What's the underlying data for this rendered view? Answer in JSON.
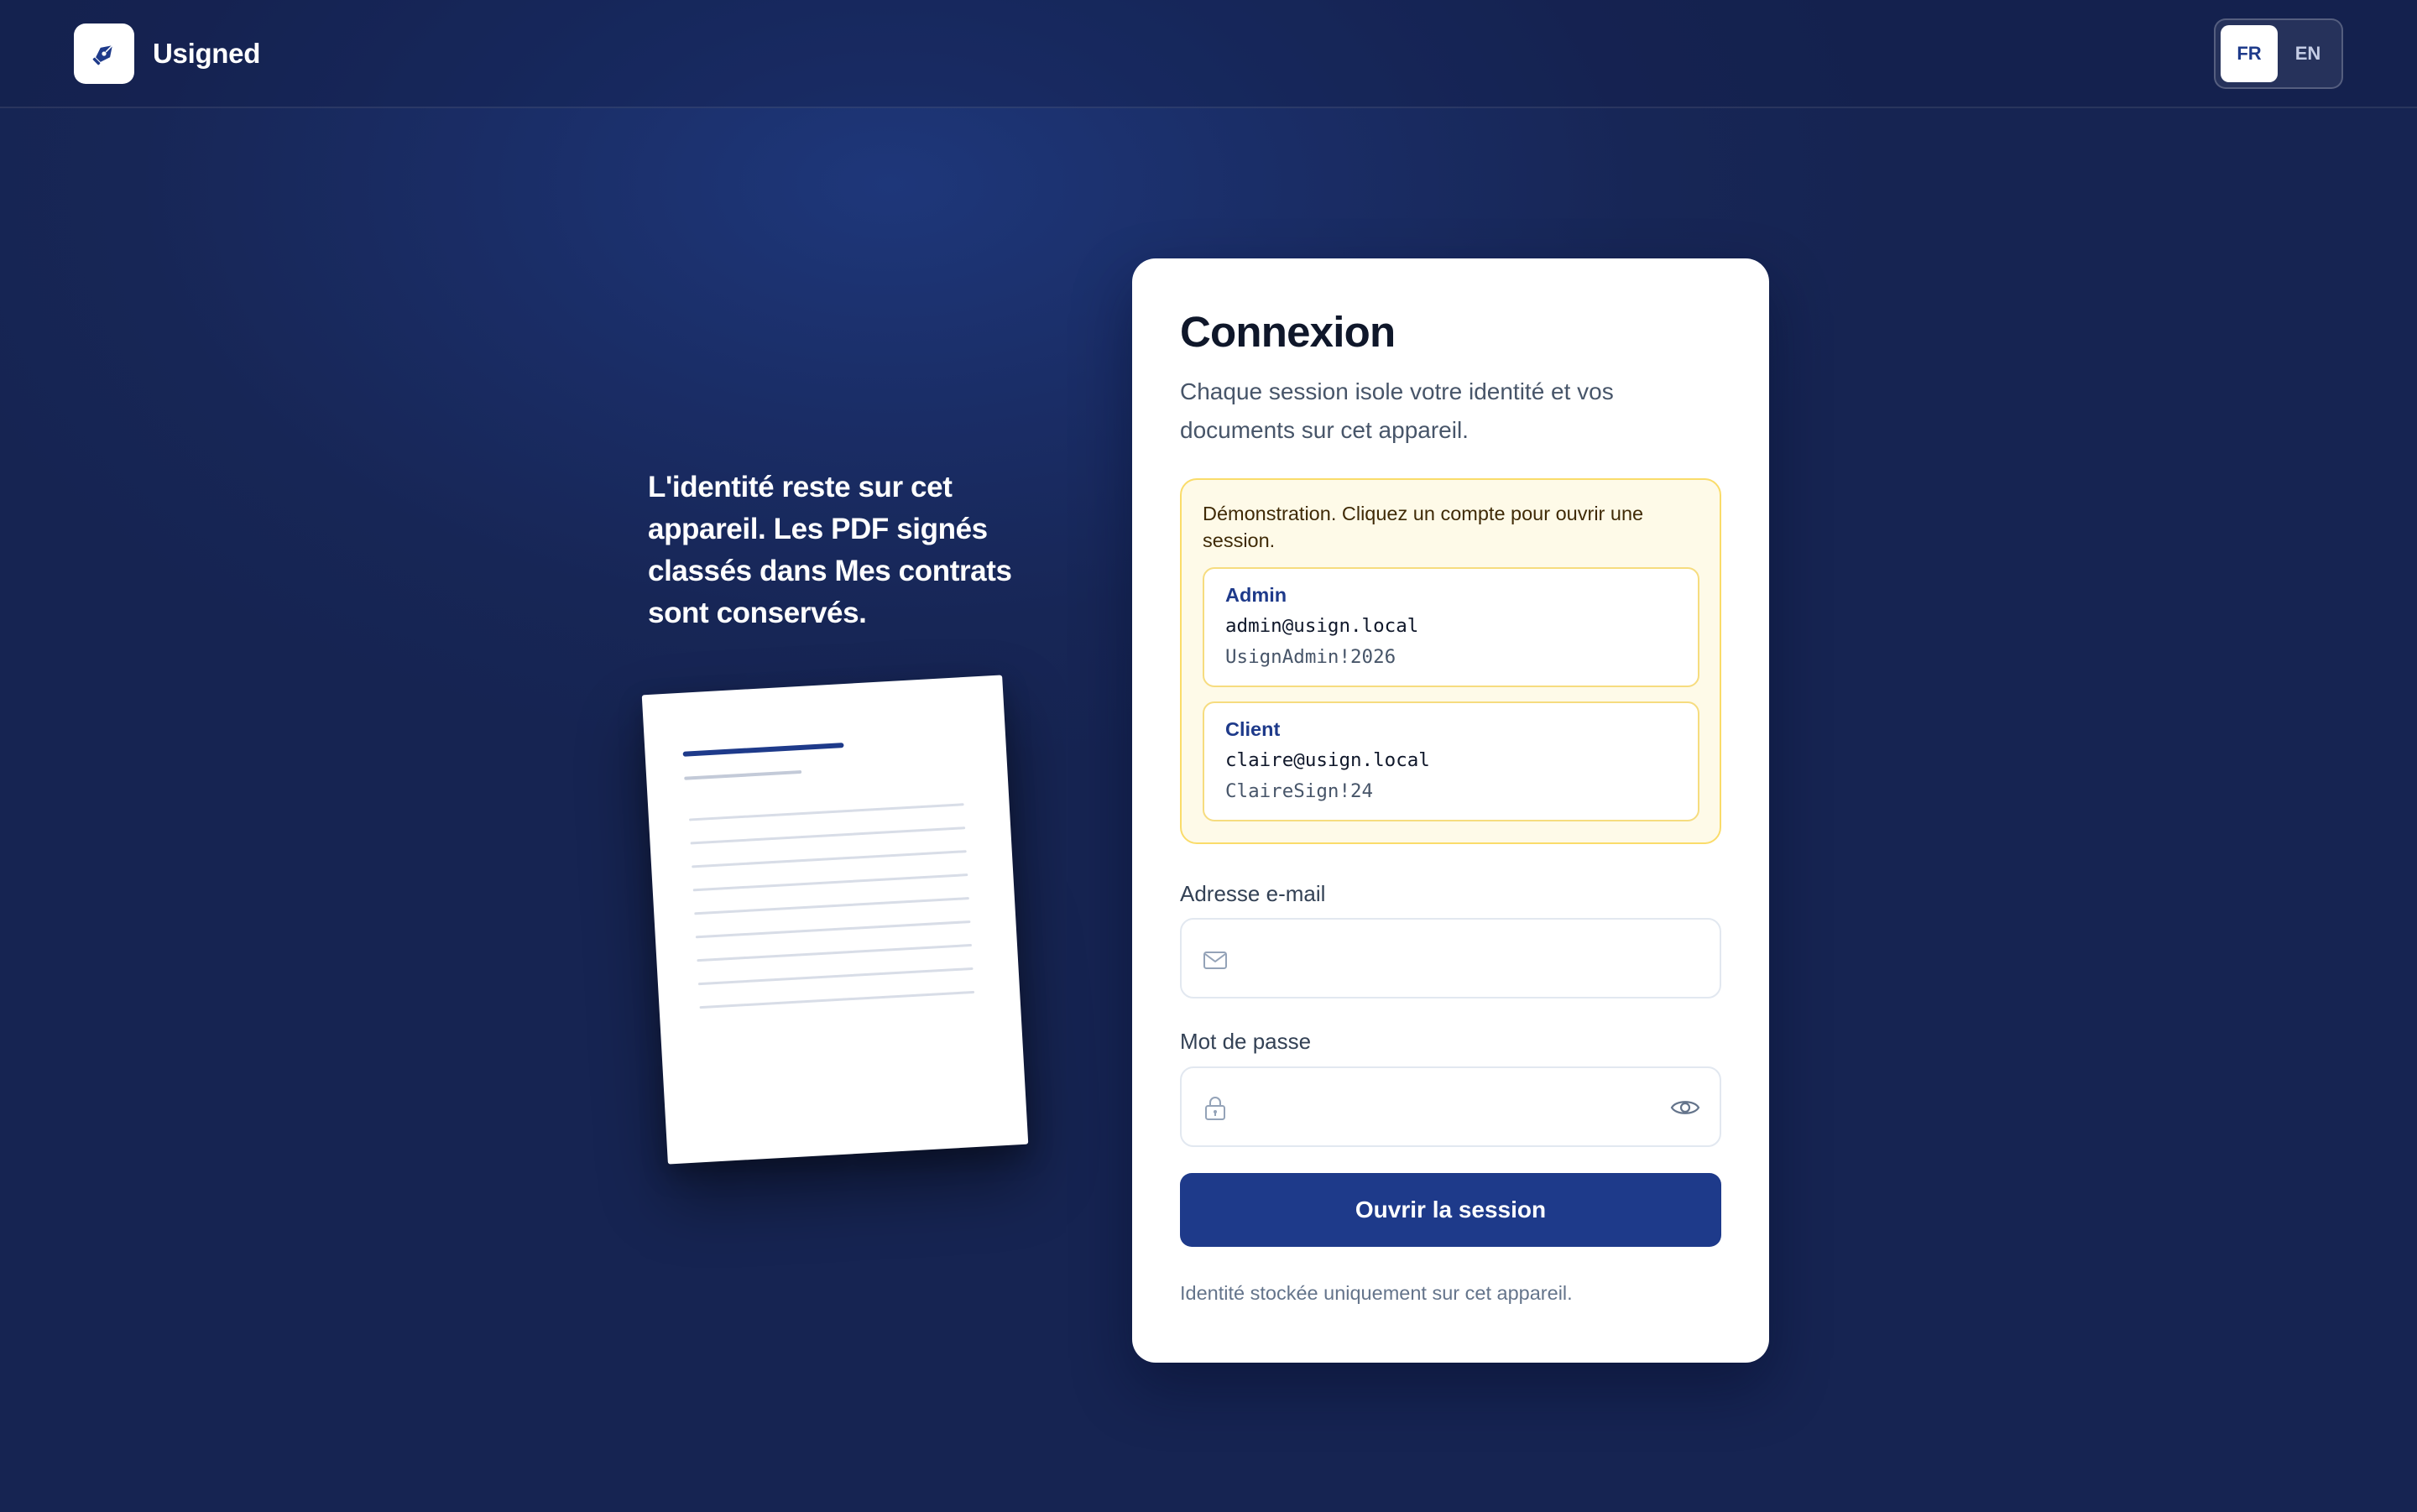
{
  "header": {
    "brand_name": "Usigned",
    "logo_icon": "pen-nib-icon",
    "languages": [
      {
        "code": "FR",
        "active": true
      },
      {
        "code": "EN",
        "active": false
      }
    ]
  },
  "hero": {
    "tagline": "L'identité reste sur cet appareil. Les PDF signés classés dans Mes contrats sont conservés.",
    "illustration": "document-illustration"
  },
  "login": {
    "title": "Connexion",
    "subtitle": "Chaque session isole votre identité et vos documents sur cet appareil.",
    "demo": {
      "note": "Démonstration. Cliquez un compte pour ouvrir une session.",
      "accounts": [
        {
          "role": "Admin",
          "email": "admin@usign.local",
          "password": "UsignAdmin!2026"
        },
        {
          "role": "Client",
          "email": "claire@usign.local",
          "password": "ClaireSign!24"
        }
      ]
    },
    "email": {
      "label": "Adresse e-mail",
      "value": "",
      "placeholder": "",
      "icon": "mail-icon"
    },
    "password": {
      "label": "Mot de passe",
      "value": "",
      "placeholder": "",
      "icon": "lock-icon",
      "toggle_icon": "eye-icon"
    },
    "submit_label": "Ouvrir la session",
    "footnote": "Identité stockée uniquement sur cet appareil."
  },
  "colors": {
    "background": "#172656",
    "accent": "#1e3a8a",
    "demo_background": "#fefae8",
    "demo_border": "#fadc6a"
  }
}
